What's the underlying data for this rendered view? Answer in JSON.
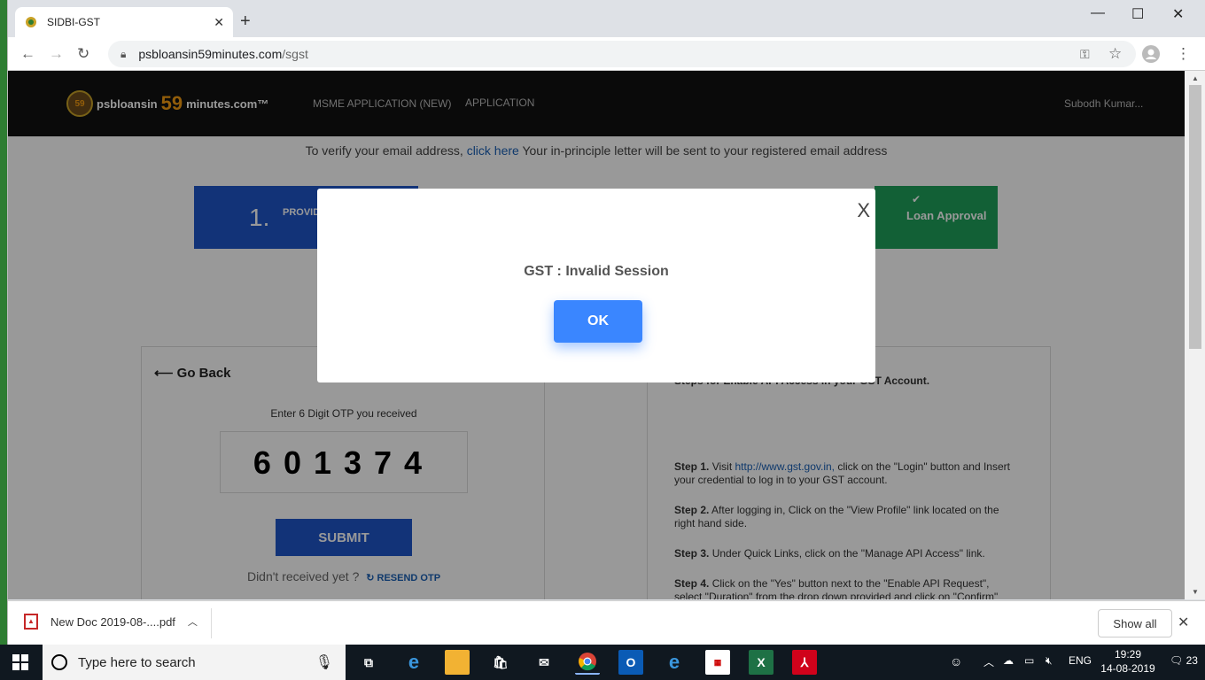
{
  "browser": {
    "tab_title": "SIDBI-GST",
    "new_tab": "+",
    "url_host": "psbloansin59minutes.com",
    "url_path": "/sgst"
  },
  "site": {
    "logo_pre": "psbloansin",
    "logo_59": "59",
    "logo_post": "minutes.com™",
    "nav_msme": "MSME APPLICATION (NEW)",
    "nav_application": "APPLICATION",
    "user_name": "Subodh Kumar...",
    "verify_pre": "To verify your email address,",
    "verify_link": "click here",
    "verify_post": "Your in-principle letter will be sent to your registered email address",
    "step1_num": "1.",
    "step1_text": "PROVIDE YOUR D",
    "step_loan": "Loan Approval",
    "go_back": "Go Back",
    "otp_label": "Enter 6 Digit OTP you received",
    "otp_value": "601374",
    "submit": "SUBMIT",
    "resend_q": "Didn't received yet ?",
    "resend_link": "RESEND OTP",
    "rp_heading": "Steps for Enable API Access in your GST Account.",
    "steps": [
      {
        "label": "Step 1.",
        "pre": "Visit",
        "link": "http://www.gst.gov.in,",
        "post": "click on the \"Login\" button and Insert your credential to log in to your GST account."
      },
      {
        "label": "Step 2.",
        "pre": "After logging in, Click on the \"View Profile\" link located on the right hand side.",
        "link": "",
        "post": ""
      },
      {
        "label": "Step 3.",
        "pre": "Under Quick Links, click on the \"Manage API Access\" link.",
        "link": "",
        "post": ""
      },
      {
        "label": "Step 4.",
        "pre": "Click on the \"Yes\" button next to the \"Enable API Request\", select \"Duration\" from the drop down provided and click on \"Confirm\"",
        "link": "",
        "post": ""
      }
    ]
  },
  "modal": {
    "close": "X",
    "message": "GST : Invalid Session",
    "ok": "OK"
  },
  "downloads": {
    "file": "New Doc 2019-08-....pdf",
    "show_all": "Show all"
  },
  "taskbar": {
    "search_placeholder": "Type here to search",
    "lang": "ENG",
    "time": "19:29",
    "date": "14-08-2019",
    "notifications": "23"
  }
}
